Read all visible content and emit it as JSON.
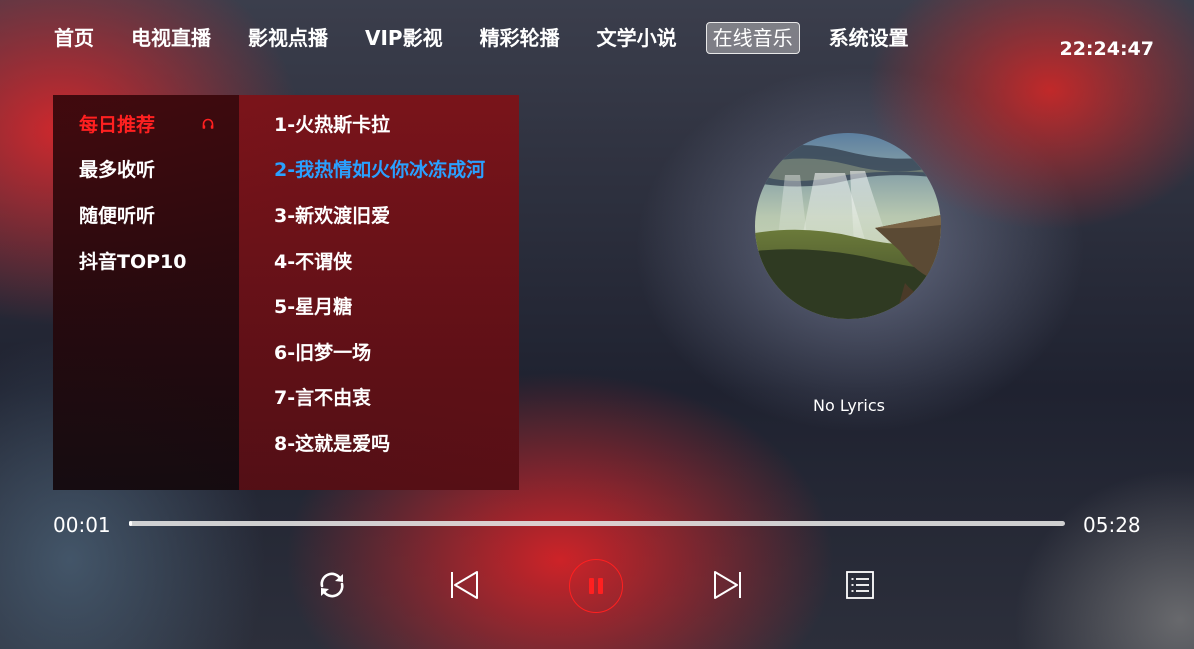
{
  "nav": {
    "tabs": [
      {
        "label": "首页"
      },
      {
        "label": "电视直播"
      },
      {
        "label": "影视点播"
      },
      {
        "label": "VIP影视"
      },
      {
        "label": "精彩轮播"
      },
      {
        "label": "文学小说"
      },
      {
        "label": "在线音乐",
        "active": true
      },
      {
        "label": "系统设置"
      }
    ],
    "clock": "22:24:47"
  },
  "categories": {
    "items": [
      {
        "label": "每日推荐",
        "active": true
      },
      {
        "label": "最多收听"
      },
      {
        "label": "随便听听"
      },
      {
        "label": "抖音TOP10"
      }
    ],
    "active_icon": "headphone-icon"
  },
  "songs": {
    "items": [
      {
        "label": "1-火热斯卡拉"
      },
      {
        "label": "2-我热情如火你冰冻成河",
        "active": true
      },
      {
        "label": "3-新欢渡旧爱"
      },
      {
        "label": "4-不谓侠"
      },
      {
        "label": "5-星月糖"
      },
      {
        "label": "6-旧梦一场"
      },
      {
        "label": "7-言不由衷"
      },
      {
        "label": "8-这就是爱吗"
      }
    ]
  },
  "player": {
    "lyrics": "No Lyrics",
    "elapsed": "00:01",
    "total": "05:28",
    "progress_fraction": 0.003,
    "controls": [
      {
        "name": "repeat-icon"
      },
      {
        "name": "previous-icon"
      },
      {
        "name": "pause-icon"
      },
      {
        "name": "next-icon"
      },
      {
        "name": "playlist-icon"
      }
    ]
  },
  "colors": {
    "accent_red": "#ff2020",
    "active_song_blue": "#2aa0ff"
  }
}
